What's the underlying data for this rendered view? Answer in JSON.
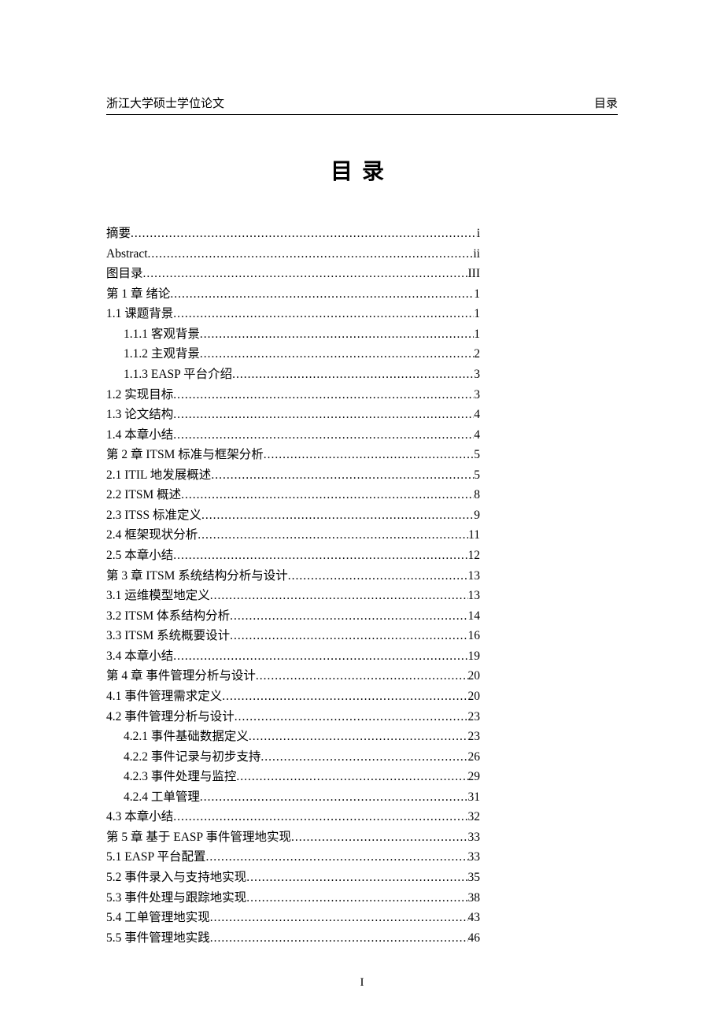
{
  "header": {
    "left": "浙江大学硕士学位论文",
    "right": "目录"
  },
  "title": "目录",
  "entries": [
    {
      "label": "摘要 ",
      "page": "i",
      "indent": 0
    },
    {
      "label": "Abstract",
      "page": "ii",
      "indent": 0
    },
    {
      "label": "图目录 ",
      "page": "III",
      "indent": 0
    },
    {
      "label": "第 1 章   绪论 ",
      "page": "1",
      "indent": 0
    },
    {
      "label": "1.1   课题背景 ",
      "page": "1",
      "indent": 0
    },
    {
      "label": "1.1.1   客观背景 ",
      "page": "1",
      "indent": 1
    },
    {
      "label": "1.1.2   主观背景 ",
      "page": "2",
      "indent": 1
    },
    {
      "label": "1.1.3   EASP 平台介绍 ",
      "page": "3",
      "indent": 1
    },
    {
      "label": "1.2   实现目标 ",
      "page": "3",
      "indent": 0
    },
    {
      "label": "1.3   论文结构 ",
      "page": "4",
      "indent": 0
    },
    {
      "label": "1.4   本章小结 ",
      "page": "4",
      "indent": 0
    },
    {
      "label": "第 2 章   ITSM 标准与框架分析",
      "page": "5",
      "indent": 0
    },
    {
      "label": "2.1   ITIL 地发展概述",
      "page": "5",
      "indent": 0
    },
    {
      "label": "2.2   ITSM 概述",
      "page": "8",
      "indent": 0
    },
    {
      "label": "2.3   ITSS 标准定义",
      "page": "9",
      "indent": 0
    },
    {
      "label": "2.4   框架现状分析 ",
      "page": "11",
      "indent": 0
    },
    {
      "label": "2.5   本章小结 ",
      "page": "12",
      "indent": 0
    },
    {
      "label": "第 3 章   ITSM 系统结构分析与设计",
      "page": "13",
      "indent": 0
    },
    {
      "label": "3.1   运维模型地定义 ",
      "page": "13",
      "indent": 0
    },
    {
      "label": "3.2   ITSM 体系结构分析",
      "page": "14",
      "indent": 0
    },
    {
      "label": "3.3   ITSM 系统概要设计",
      "page": "16",
      "indent": 0
    },
    {
      "label": "3.4   本章小结 ",
      "page": "19",
      "indent": 0
    },
    {
      "label": "第 4 章   事件管理分析与设计 ",
      "page": "20",
      "indent": 0
    },
    {
      "label": "4.1   事件管理需求定义 ",
      "page": "20",
      "indent": 0
    },
    {
      "label": "4.2   事件管理分析与设计 ",
      "page": "23",
      "indent": 0
    },
    {
      "label": "4.2.1   事件基础数据定义 ",
      "page": "23",
      "indent": 1
    },
    {
      "label": "4.2.2   事件记录与初步支持 ",
      "page": "26",
      "indent": 1
    },
    {
      "label": "4.2.3   事件处理与监控 ",
      "page": "29",
      "indent": 1
    },
    {
      "label": "4.2.4   工单管理 ",
      "page": "31",
      "indent": 1
    },
    {
      "label": "4.3   本章小结 ",
      "page": "32",
      "indent": 0
    },
    {
      "label": "第 5 章   基于 EASP 事件管理地实现",
      "page": "33",
      "indent": 0
    },
    {
      "label": "5.1   EASP 平台配置 ",
      "page": "33",
      "indent": 0
    },
    {
      "label": "5.2   事件录入与支持地实现 ",
      "page": "35",
      "indent": 0
    },
    {
      "label": "5.3   事件处理与跟踪地实现 ",
      "page": "38",
      "indent": 0
    },
    {
      "label": "5.4   工单管理地实现 ",
      "page": "43",
      "indent": 0
    },
    {
      "label": "5.5   事件管理地实践 ",
      "page": "46",
      "indent": 0
    }
  ],
  "footer": "I"
}
